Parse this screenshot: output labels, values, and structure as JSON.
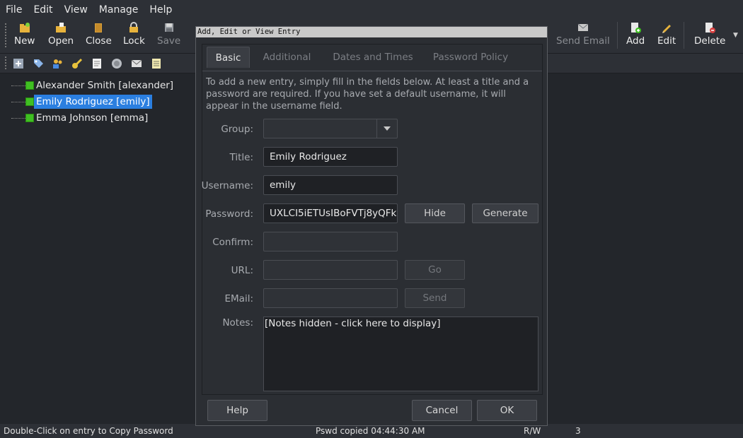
{
  "menu": [
    "File",
    "Edit",
    "View",
    "Manage",
    "Help"
  ],
  "toolbar": {
    "new": "New",
    "open": "Open",
    "close": "Close",
    "lock": "Lock",
    "save": "Save",
    "send_email": "Send Email",
    "add": "Add",
    "edit": "Edit",
    "delete": "Delete"
  },
  "tree": {
    "entries": [
      {
        "label": "Alexander Smith [alexander]",
        "selected": false
      },
      {
        "label": "Emily Rodriguez [emily]",
        "selected": true
      },
      {
        "label": "Emma Johnson [emma]",
        "selected": false
      }
    ]
  },
  "status": {
    "hint": "Double-Click on entry to Copy Password",
    "copied": "Pswd copied 04:44:30 AM",
    "mode": "R/W",
    "count": "3"
  },
  "dialog": {
    "title": "Add, Edit or View Entry",
    "tabs": [
      "Basic",
      "Additional",
      "Dates and Times",
      "Password Policy"
    ],
    "intro": "To add a new entry, simply fill in the fields below. At least a title and a password are required. If you have set a default username, it will appear in the username field.",
    "labels": {
      "group": "Group:",
      "title": "Title:",
      "username": "Username:",
      "password": "Password:",
      "confirm": "Confirm:",
      "url": "URL:",
      "email": "EMail:",
      "notes": "Notes:"
    },
    "values": {
      "group": "",
      "title": "Emily Rodriguez",
      "username": "emily",
      "password": "UXLCI5iETUsIBoFVTj8yQFk",
      "confirm": "",
      "url": "",
      "email": "",
      "notes": "[Notes hidden - click here to display]"
    },
    "buttons": {
      "hide": "Hide",
      "generate": "Generate",
      "go": "Go",
      "send": "Send",
      "help": "Help",
      "cancel": "Cancel",
      "ok": "OK"
    }
  },
  "colors": {
    "selection": "#2b7fe0",
    "entry_icon": "#3fbf22"
  }
}
